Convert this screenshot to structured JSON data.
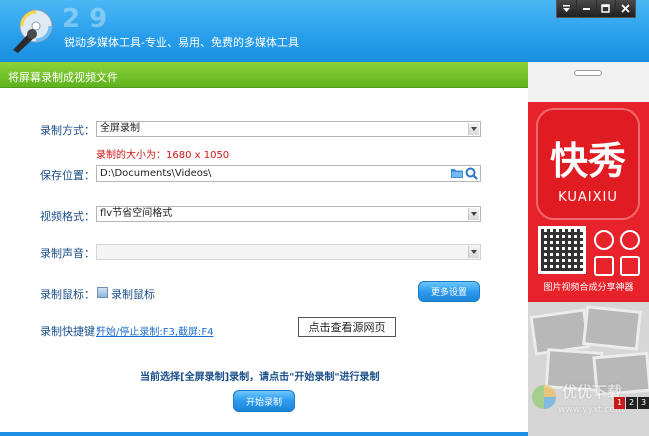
{
  "header": {
    "tagline": "锐动多媒体工具-专业、易用、免费的多媒体工具",
    "window_controls": [
      "menu-icon",
      "minimize-icon",
      "maximize-icon",
      "close-icon"
    ]
  },
  "section": {
    "title": "将屏幕录制成视频文件"
  },
  "form": {
    "record_mode": {
      "label": "录制方式：",
      "value": "全屏录制"
    },
    "size_info": "录制的大小为：1680 x 1050",
    "save_location": {
      "label": "保存位置：",
      "value": "D:\\Documents\\Videos\\"
    },
    "video_format": {
      "label": "视频格式：",
      "value": "flv节省空间格式"
    },
    "record_audio": {
      "label": "录制声音：",
      "value": ""
    },
    "record_mouse": {
      "label": "录制鼠标：",
      "checkbox_label": "录制鼠标",
      "checked": true
    },
    "more_settings": "更多设置",
    "hotkey": {
      "label": "录制快捷键：",
      "value": "开始/停止录制:F3,截屏:F4"
    },
    "tooltip": "点击查看源网页",
    "hint": "当前选择[全屏录制]录制，请点击\"开始录制\"进行录制",
    "start_button": "开始录制"
  },
  "ad": {
    "app_name": "快秀",
    "app_sub": "KUAIXIU",
    "slogan": "图片视频合成分享神器",
    "pager": [
      "1",
      "2",
      "3"
    ],
    "active_page": 0
  },
  "watermark": {
    "text": "优优下载",
    "url": "www.yyxt.com"
  },
  "colors": {
    "header_blue": "#2aa0ec",
    "section_green": "#5fb11e",
    "label_blue": "#1b4f8a",
    "warning_red": "#d21515",
    "ad_red": "#e8222a"
  }
}
